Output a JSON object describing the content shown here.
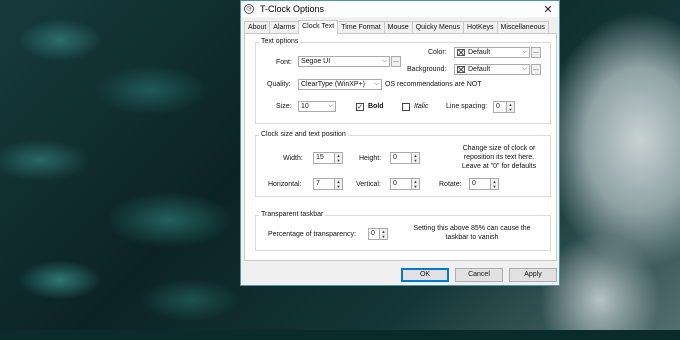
{
  "window": {
    "title": "T-Clock Options",
    "close_glyph": "✕"
  },
  "tabs": [
    {
      "label": "About"
    },
    {
      "label": "Alarms"
    },
    {
      "label": "Clock Text"
    },
    {
      "label": "Time Format"
    },
    {
      "label": "Mouse"
    },
    {
      "label": "Quicky Menus"
    },
    {
      "label": "HotKeys"
    },
    {
      "label": "Miscellaneous"
    }
  ],
  "text_options": {
    "group_title": "Text options",
    "font_label": "Font:",
    "font_value": "Segoe UI",
    "more_label": "...",
    "color_label": "Color:",
    "color_value": "Default",
    "background_label": "Background:",
    "background_value": "Default",
    "quality_label": "Quality:",
    "quality_value": "ClearType (WinXP+)",
    "quality_note": "OS recommendations are NOT",
    "size_label": "Size:",
    "size_value": "10",
    "bold_label": "Bold",
    "bold_checked": true,
    "italic_label": "Italic",
    "italic_checked": false,
    "line_spacing_label": "Line spacing:",
    "line_spacing_value": "0"
  },
  "clock_size": {
    "group_title": "Clock size and text position",
    "width_label": "Width:",
    "width_value": "15",
    "height_label": "Height:",
    "height_value": "0",
    "help_text": "Change size of clock or reposition its text here. Leave at \"0\" for defaults",
    "horizontal_label": "Horizontal:",
    "horizontal_value": "7",
    "vertical_label": "Vertical:",
    "vertical_value": "0",
    "rotate_label": "Rotate:",
    "rotate_value": "0"
  },
  "transparent": {
    "group_title": "Transparent taskbar",
    "percentage_label": "Percentage of transparency:",
    "percentage_value": "0",
    "warning": "Setting this above 85% can cause the taskbar to vanish"
  },
  "buttons": {
    "ok": "OK",
    "cancel": "Cancel",
    "apply": "Apply"
  },
  "icons": {
    "app": "clock-icon",
    "dropdown": "chevron-down-icon",
    "spin_up": "arrow-up-icon",
    "spin_down": "arrow-down-icon"
  },
  "colors": {
    "window_border": "#4a9aa0",
    "accent": "#0078d7"
  }
}
